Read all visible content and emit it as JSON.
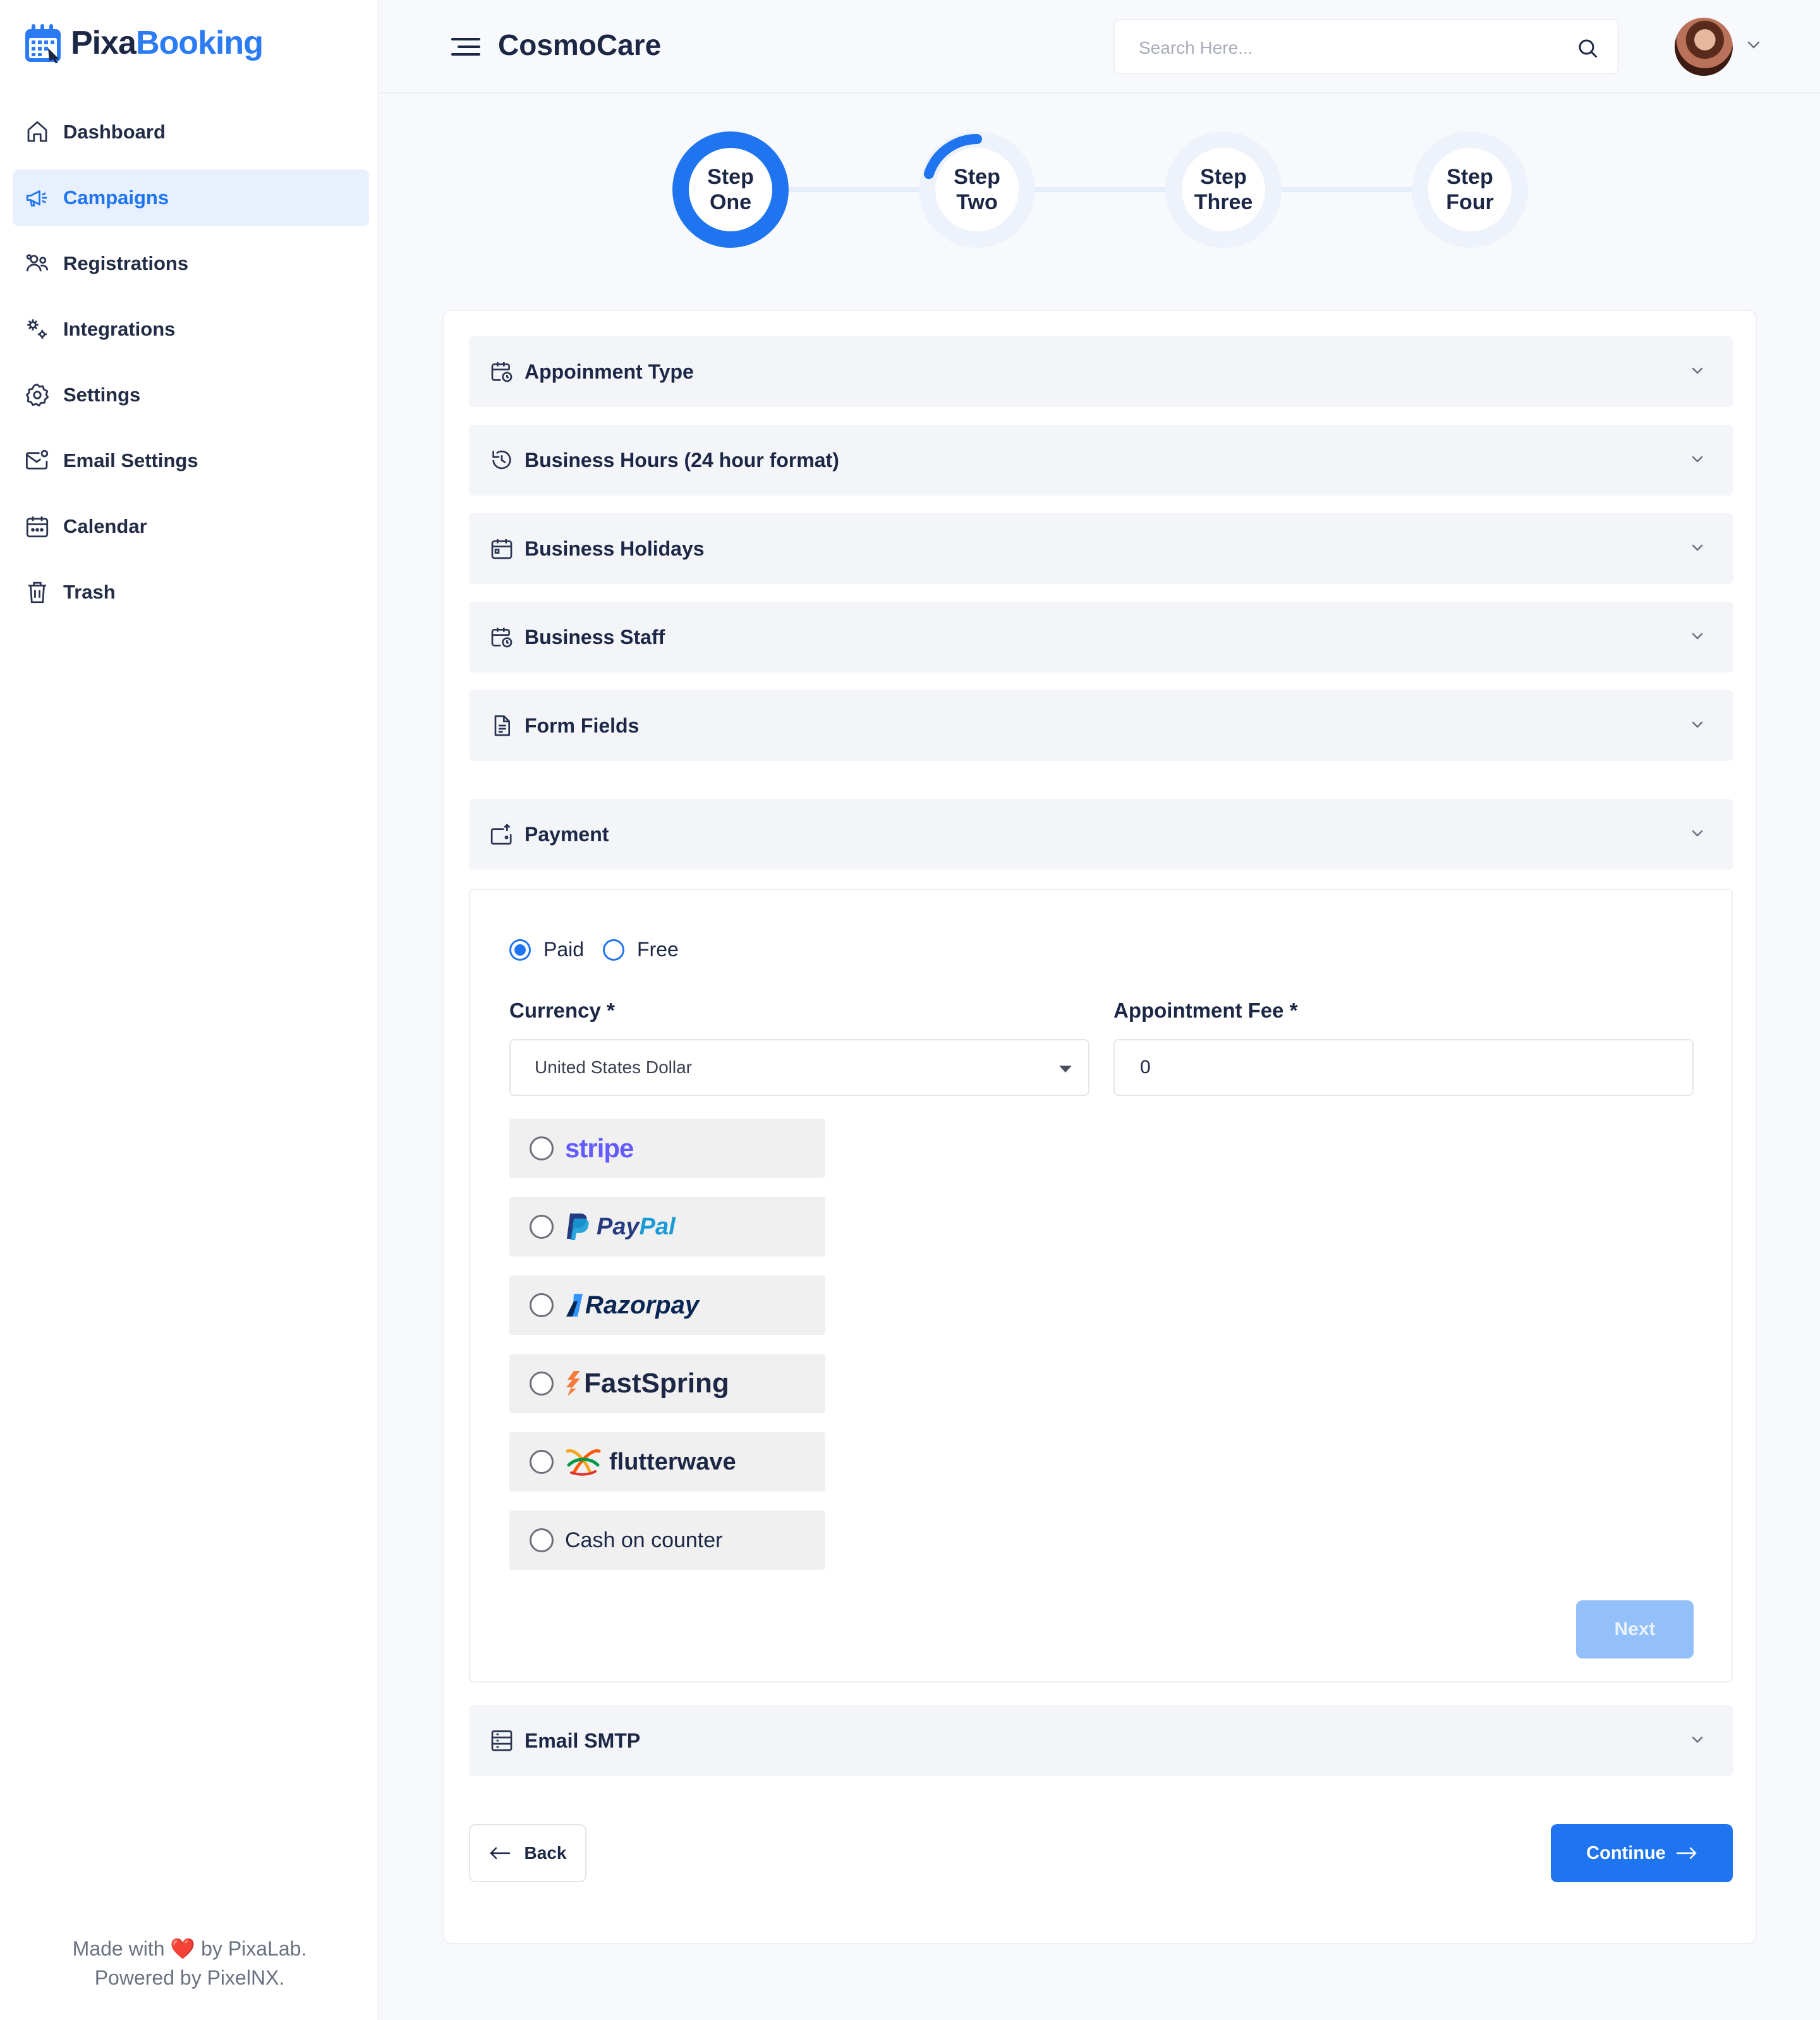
{
  "brand": {
    "part1": "Pixa",
    "part2": "Booking",
    "accent": "#2a7bf4"
  },
  "sidebar": {
    "items": [
      {
        "label": "Dashboard",
        "icon": "home-icon",
        "active": false
      },
      {
        "label": "Campaigns",
        "icon": "megaphone-icon",
        "active": true
      },
      {
        "label": "Registrations",
        "icon": "users-icon",
        "active": false
      },
      {
        "label": "Integrations",
        "icon": "integrations-icon",
        "active": false
      },
      {
        "label": "Settings",
        "icon": "gear-icon",
        "active": false
      },
      {
        "label": "Email Settings",
        "icon": "mail-settings-icon",
        "active": false
      },
      {
        "label": "Calendar",
        "icon": "calendar-icon",
        "active": false
      },
      {
        "label": "Trash",
        "icon": "trash-icon",
        "active": false
      }
    ],
    "footer": {
      "made_with": "Made with",
      "heart": "❤️",
      "by": "by PixaLab.",
      "powered": "Powered by PixelNX."
    }
  },
  "header": {
    "title": "CosmoCare",
    "search_placeholder": "Search Here..."
  },
  "steps": [
    {
      "line1": "Step",
      "line2": "One",
      "progress": 1.0
    },
    {
      "line1": "Step",
      "line2": "Two",
      "progress": 0.2
    },
    {
      "line1": "Step",
      "line2": "Three",
      "progress": 0
    },
    {
      "line1": "Step",
      "line2": "Four",
      "progress": 0
    }
  ],
  "sections": {
    "appointment_type": "Appoinment Type",
    "business_hours": "Business Hours (24 hour format)",
    "business_holidays": "Business Holidays",
    "business_staff": "Business Staff",
    "form_fields": "Form Fields",
    "payment": "Payment",
    "email_smtp": "Email SMTP"
  },
  "payment": {
    "paid_label": "Paid",
    "free_label": "Free",
    "selected": "Paid",
    "currency_label": "Currency *",
    "currency_value": "United States Dollar",
    "fee_label": "Appointment Fee *",
    "fee_value": "0",
    "gateways": [
      {
        "name": "stripe",
        "display": "stripe",
        "color": "#635bff"
      },
      {
        "name": "paypal",
        "display1": "Pay",
        "display2": "Pal",
        "color1": "#253b80",
        "color2": "#179bd7"
      },
      {
        "name": "razorpay",
        "display": "Razorpay",
        "color": "#072654"
      },
      {
        "name": "fastspring",
        "display": "FastSpring",
        "color": "#1c2745"
      },
      {
        "name": "flutterwave",
        "display": "flutterwave",
        "color": "#1c2745"
      },
      {
        "name": "cash",
        "display": "Cash on counter",
        "color": "#1c2745"
      }
    ],
    "next_label": "Next"
  },
  "actions": {
    "back_label": "Back",
    "continue_label": "Continue"
  }
}
